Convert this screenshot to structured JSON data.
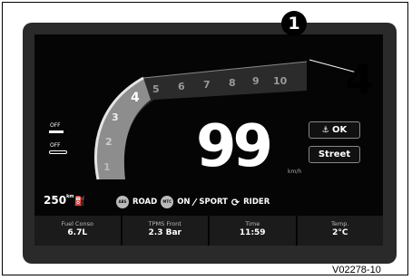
{
  "callout": {
    "number": "1"
  },
  "gear": "4",
  "rev_scale": [
    "1",
    "2",
    "3",
    "4",
    "5",
    "6",
    "7",
    "8",
    "9",
    "10"
  ],
  "speed": {
    "value": "99",
    "unit": "km/h"
  },
  "indicators": {
    "top_off": "OFF",
    "bottom_off": "OFF"
  },
  "fuel": {
    "value": "250",
    "unit": "km"
  },
  "buttons": {
    "ok": "OK",
    "mode": "Street"
  },
  "modes": {
    "abs_badge": "ABS",
    "abs_label": "ROAD",
    "mtc_badge": "MTC",
    "mtc_label": "ON",
    "sport_label": "SPORT",
    "rider_label": "RIDER"
  },
  "bottom_bar": [
    {
      "label": "Fuel Conso",
      "value": "6.7L"
    },
    {
      "label": "TPMS Front",
      "value": "2.3 Bar"
    },
    {
      "label": "Time",
      "value": "11:59"
    },
    {
      "label": "Temp.",
      "value": "2°C"
    }
  ],
  "figure_code": "V02278-10"
}
